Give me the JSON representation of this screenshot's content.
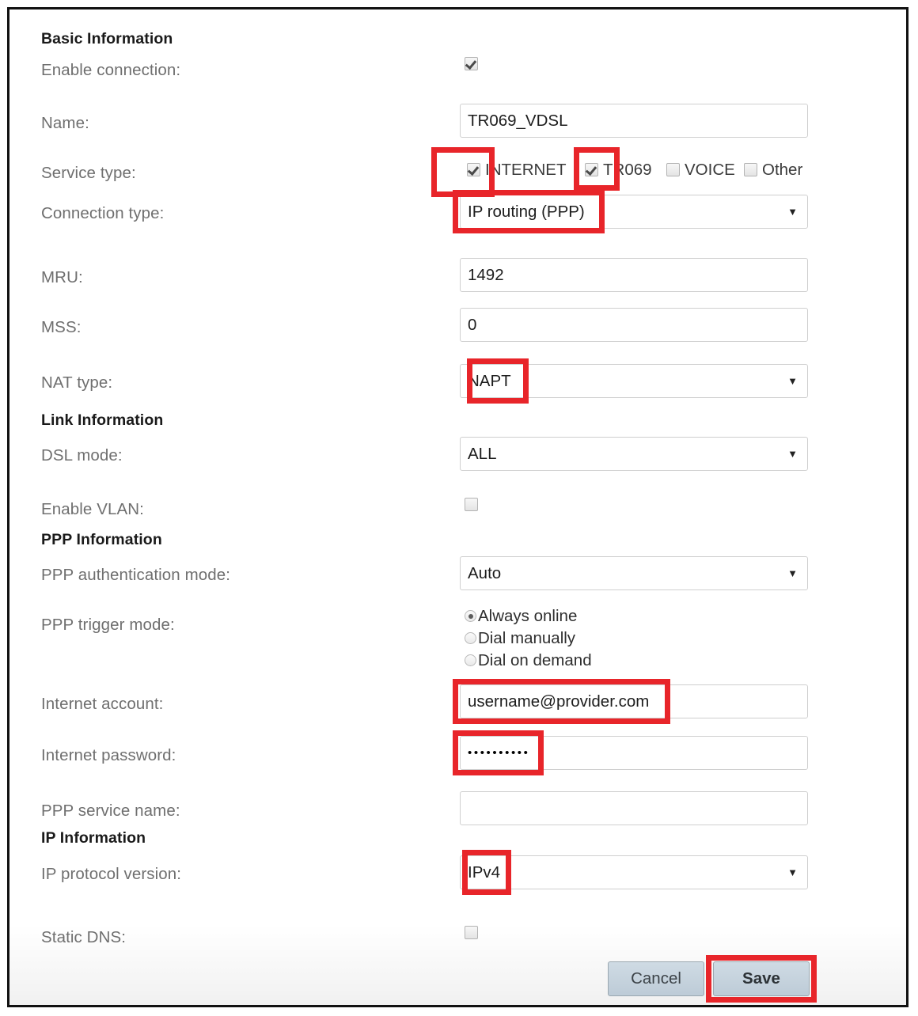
{
  "form": {
    "sections": [
      {
        "title": "Basic Information"
      },
      {
        "title": "Link Information"
      },
      {
        "title": "PPP Information"
      },
      {
        "title": "IP Information"
      }
    ],
    "labels": {
      "enable_connection": "Enable connection:",
      "name": "Name:",
      "service_type": "Service type:",
      "connection_type": "Connection type:",
      "mru": "MRU:",
      "mss": "MSS:",
      "nat_type": "NAT type:",
      "dsl_mode": "DSL mode:",
      "enable_vlan": "Enable VLAN:",
      "ppp_auth_mode": "PPP authentication mode:",
      "ppp_trigger_mode": "PPP trigger mode:",
      "internet_account": "Internet account:",
      "internet_password": "Internet password:",
      "ppp_service_name": "PPP service name:",
      "ip_protocol_version": "IP protocol version:",
      "static_dns": "Static DNS:"
    },
    "values": {
      "name": "TR069_VDSL",
      "connection_type": "IP routing (PPP)",
      "mru": "1492",
      "mss": "0",
      "nat_type": "NAPT",
      "dsl_mode": "ALL",
      "ppp_auth_mode": "Auto",
      "internet_account": "username@provider.com",
      "internet_password": "••••••••••",
      "ppp_service_name": "",
      "ip_protocol_version": "IPv4"
    },
    "service_type": {
      "options": [
        {
          "label": "INTERNET",
          "checked": true
        },
        {
          "label": "TR069",
          "checked": true
        },
        {
          "label": "VOICE",
          "checked": false
        },
        {
          "label": "Other",
          "checked": false
        }
      ]
    },
    "ppp_trigger_mode": {
      "options": [
        {
          "label": "Always online",
          "selected": true
        },
        {
          "label": "Dial manually",
          "selected": false
        },
        {
          "label": "Dial on demand",
          "selected": false
        }
      ]
    },
    "checkboxes": {
      "enable_connection": true,
      "enable_vlan": false,
      "static_dns": false
    },
    "caret_glyph": "▼",
    "buttons": {
      "cancel": "Cancel",
      "save": "Save"
    },
    "colors": {
      "highlight": "#e8252a",
      "label_text": "#6f6f6f",
      "button_face": "#c6d3dd"
    }
  }
}
